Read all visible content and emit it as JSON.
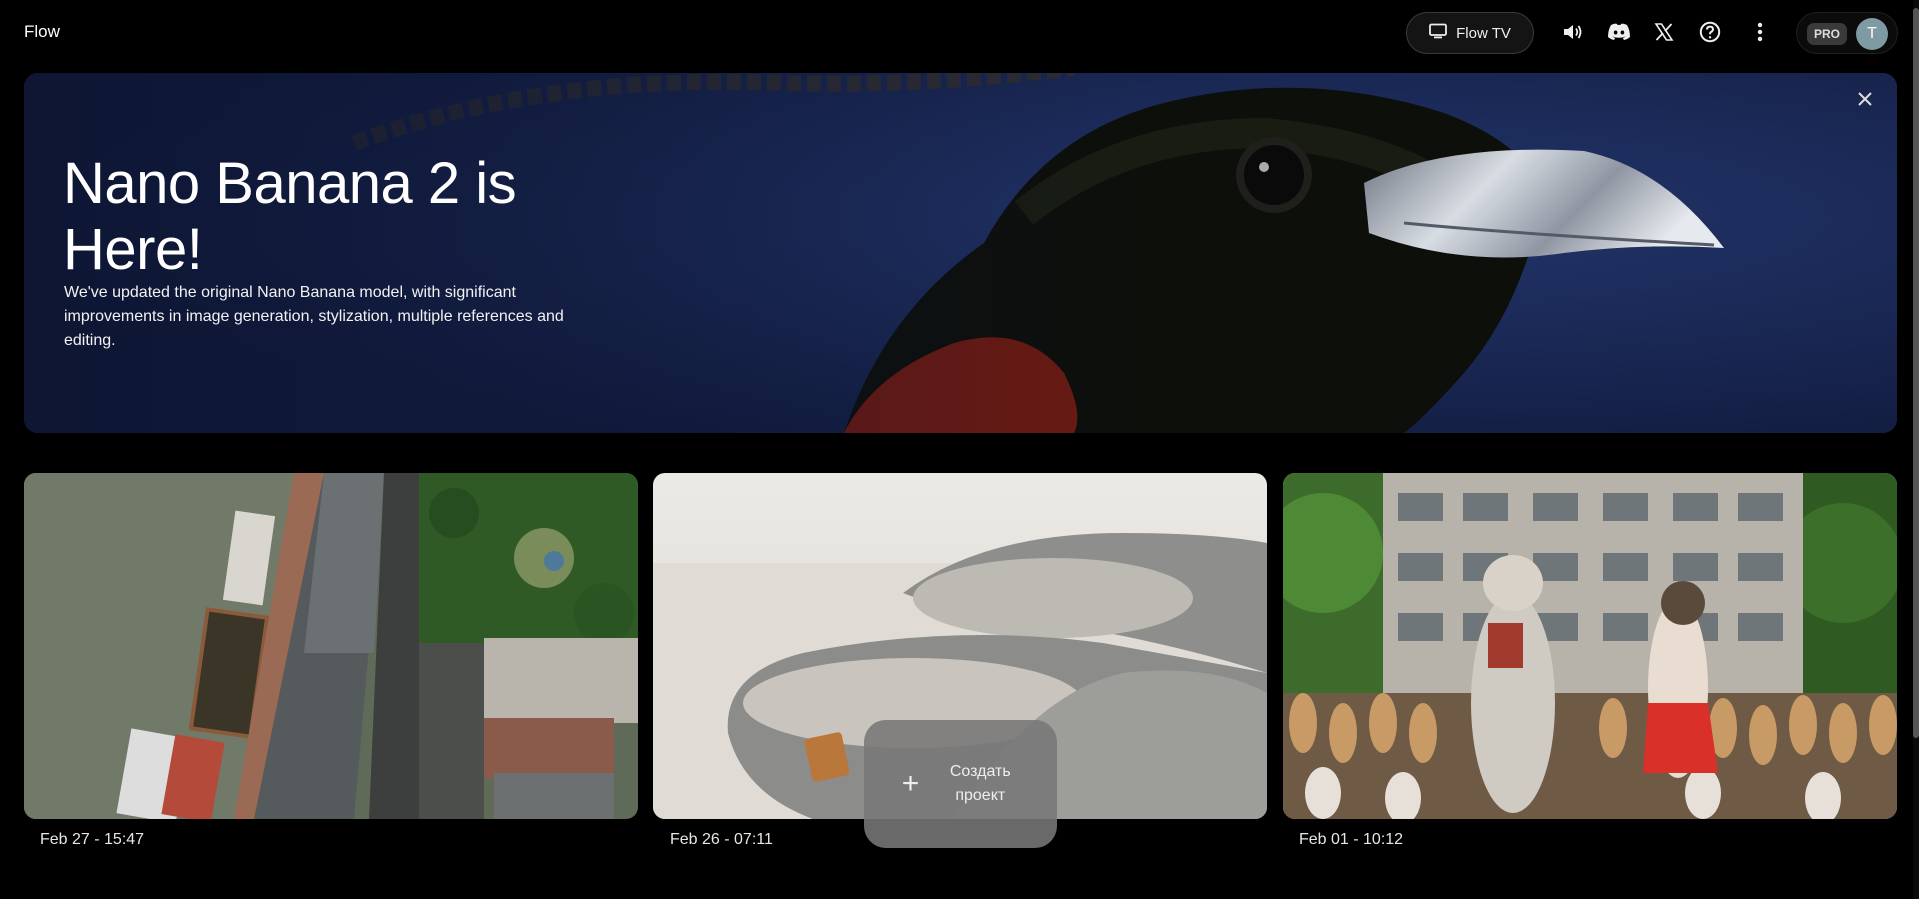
{
  "header": {
    "app_title": "Flow",
    "flow_tv_label": "Flow TV",
    "pro_label": "PRO",
    "avatar_initial": "T",
    "icons": [
      "tv-icon",
      "volume-icon",
      "discord-icon",
      "x-icon",
      "help-icon",
      "more-vert-icon"
    ]
  },
  "banner": {
    "title": "Nano Banana 2 is Here!",
    "description": "We've updated the original Nano Banana model, with significant improvements in image generation, stylization, multiple references and editing."
  },
  "projects": [
    {
      "date": "Feb 27 - 15:47",
      "thumbnail": "aerial riverside city"
    },
    {
      "date": "Feb 26 - 07:11",
      "thumbnail": "felt slippers"
    },
    {
      "date": "Feb 01 - 10:12",
      "thumbnail": "dancing cats"
    }
  ],
  "create_button": {
    "label": "Создать проект"
  },
  "colors": {
    "background": "#000000",
    "banner_blue": "#1a2b5a",
    "create_button": "#787878"
  }
}
